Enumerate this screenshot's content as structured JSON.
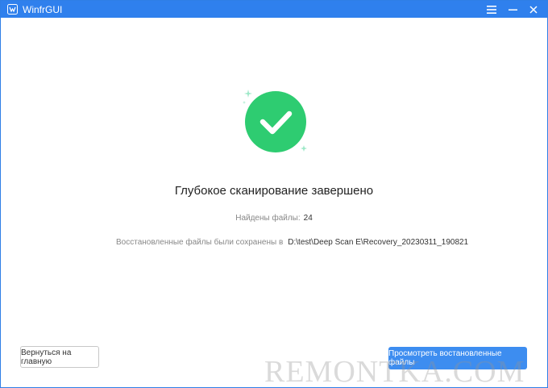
{
  "window": {
    "title": "WinfrGUI"
  },
  "icons": {
    "app_logo": "winfr-logo-icon",
    "menu": "hamburger-menu-icon",
    "minimize": "minimize-icon",
    "close": "close-icon",
    "success": "checkmark-circle-icon"
  },
  "colors": {
    "titlebar": "#2f80ed",
    "success": "#2ecc71",
    "primary_button": "#3d8df0"
  },
  "result": {
    "heading": "Глубокое сканирование завершено",
    "found_label": "Найдены файлы:",
    "found_count": "24",
    "saved_label": "Восстановленные файлы были сохранены в",
    "saved_path": "D:\\test\\Deep Scan E\\Recovery_20230311_190821"
  },
  "buttons": {
    "back": "Вернуться на главную",
    "view_recovered": "Просмотреть востановленные файлы"
  },
  "watermark": "REMONTKA.COM"
}
